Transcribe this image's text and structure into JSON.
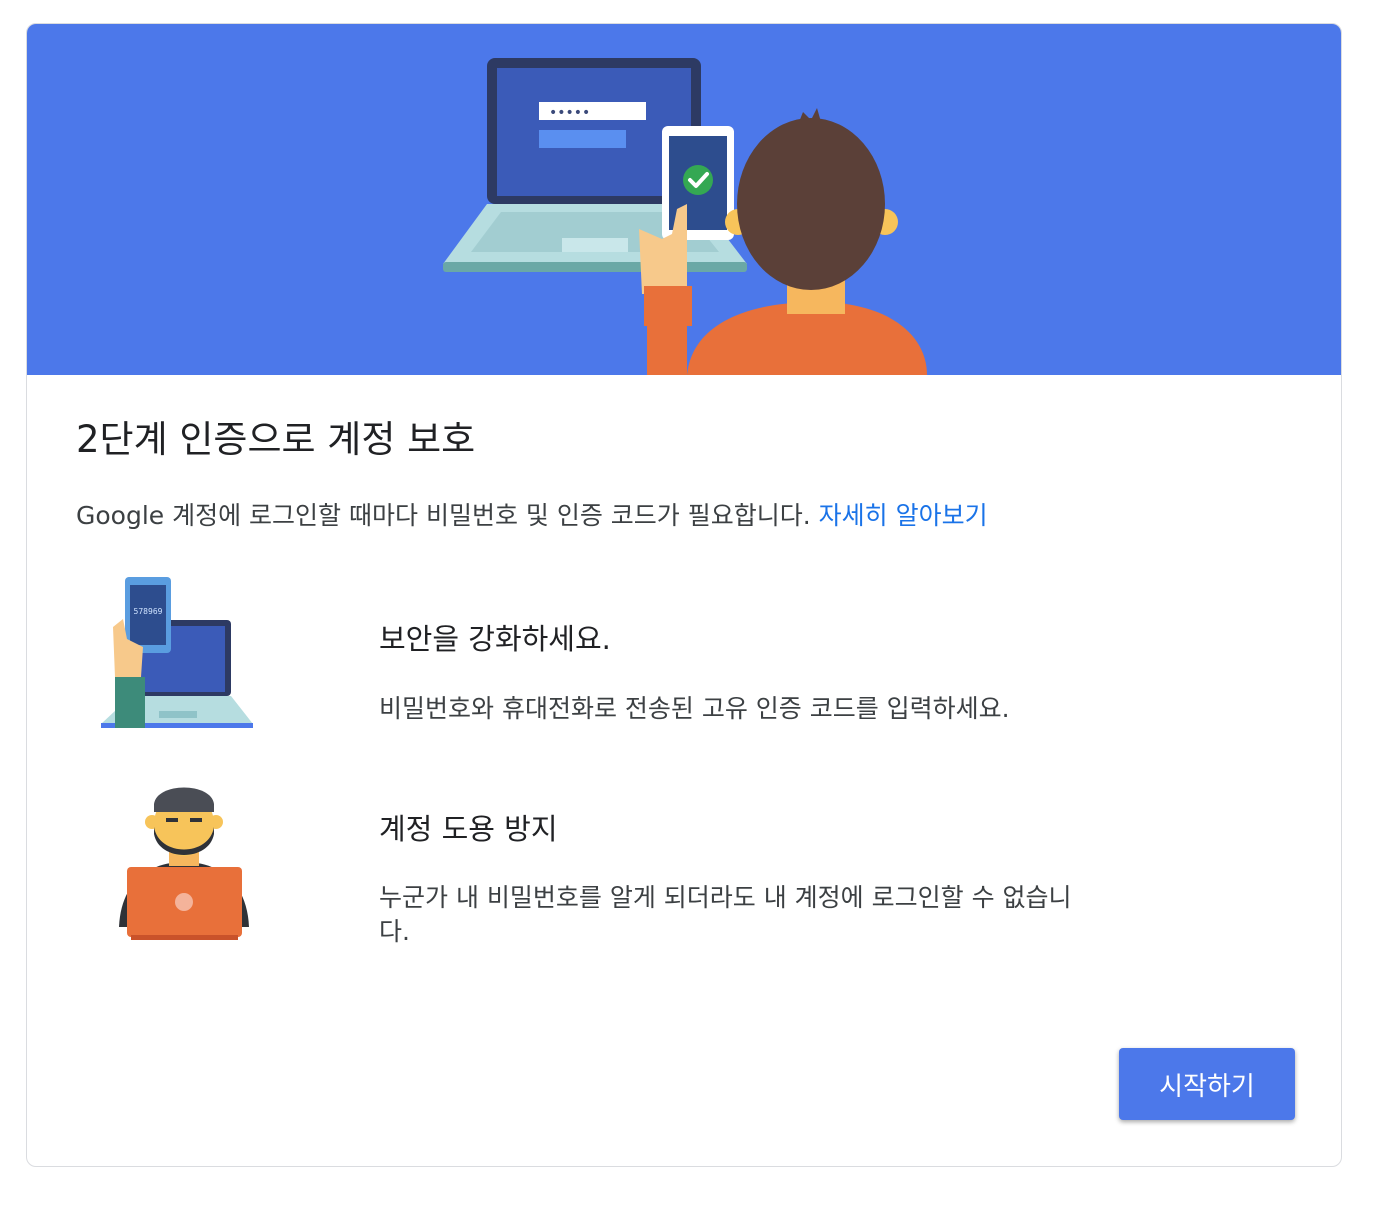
{
  "page": {
    "title": "2단계 인증으로 계정 보호",
    "description": "Google 계정에 로그인할 때마다 비밀번호 및 인증 코드가 필요합니다.",
    "learn_more_link": "자세히 알아보기"
  },
  "hero": {
    "password_mask": "•••••"
  },
  "features": [
    {
      "title": "보안을 강화하세요.",
      "text": "비밀번호와 휴대전화로 전송된 고유 인증 코드를 입력하세요.",
      "code_on_phone": "578969"
    },
    {
      "title": "계정 도용 방지",
      "text": "누군가 내 비밀번호를 알게 되더라도 내 계정에 로그인할 수 없습니다."
    }
  ],
  "actions": {
    "start_label": "시작하기"
  },
  "colors": {
    "accent": "#4c78ea",
    "link": "#1a73e8"
  }
}
